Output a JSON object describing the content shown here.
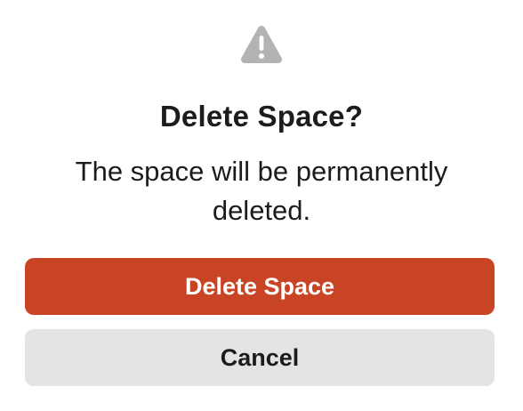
{
  "dialog": {
    "icon": "warning-triangle-icon",
    "title": "Delete Space?",
    "message": "The space will be permanently\ndeleted.",
    "confirm_label": "Delete Space",
    "cancel_label": "Cancel"
  },
  "colors": {
    "icon": "#b3b3b3",
    "danger": "#c84424",
    "cancel_bg": "#e4e4e7",
    "text": "#1c1c1e"
  }
}
